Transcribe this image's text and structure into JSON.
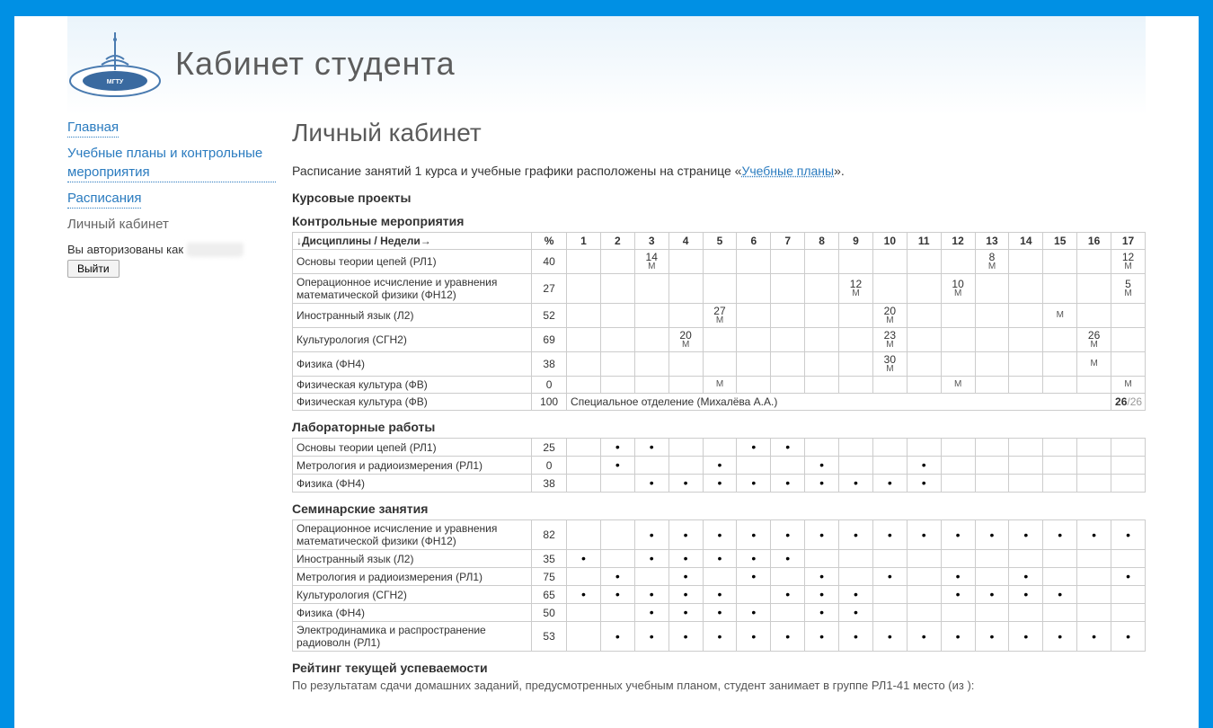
{
  "site": {
    "title": "Кабинет студента"
  },
  "nav": {
    "items": [
      {
        "label": "Главная",
        "current": false
      },
      {
        "label": "Учебные планы и контрольные мероприятия",
        "current": false
      },
      {
        "label": "Расписания",
        "current": false
      },
      {
        "label": "Личный кабинет",
        "current": true
      }
    ],
    "auth_prefix": "Вы авторизованы как ",
    "auth_user": "██████",
    "logout": "Выйти"
  },
  "page": {
    "heading": "Личный кабинет",
    "info_prefix": "Расписание занятий 1 курса и учебные графики расположены на странице «",
    "info_link": "Учебные планы",
    "info_suffix": "».",
    "section_projects": "Курсовые проекты",
    "section_km": "Контрольные мероприятия",
    "section_lab": "Лабораторные работы",
    "section_sem": "Семинарские занятия",
    "section_rating": "Рейтинг текущей успеваемости",
    "rating_tail": "По результатам сдачи домашних заданий, предусмотренных учебным планом, студент занимает в группе РЛ1-41 место (из ):"
  },
  "table_header": {
    "corner": "↓Дисциплины / Недели→",
    "pct": "%",
    "weeks": [
      "1",
      "2",
      "3",
      "4",
      "5",
      "6",
      "7",
      "8",
      "9",
      "10",
      "11",
      "12",
      "13",
      "14",
      "15",
      "16",
      "17"
    ]
  },
  "km_rows": [
    {
      "name": "Основы теории цепей (РЛ1)",
      "pct": "40",
      "cells": {
        "3": {
          "n": "14",
          "s": "М"
        },
        "13": {
          "n": "8",
          "s": "М"
        },
        "17": {
          "n": "12",
          "s": "М"
        }
      }
    },
    {
      "name": "Операционное исчисление и уравнения математической физики (ФН12)",
      "pct": "27",
      "cells": {
        "9": {
          "n": "12",
          "s": "М"
        },
        "12": {
          "n": "10",
          "s": "М"
        },
        "17": {
          "n": "5",
          "s": "М"
        }
      }
    },
    {
      "name": "Иностранный язык (Л2)",
      "pct": "52",
      "cells": {
        "5": {
          "n": "27",
          "s": "М"
        },
        "10": {
          "n": "20",
          "s": "М"
        },
        "15": {
          "n": "",
          "s": "М"
        }
      }
    },
    {
      "name": "Культурология (СГН2)",
      "pct": "69",
      "cells": {
        "4": {
          "n": "20",
          "s": "М"
        },
        "10": {
          "n": "23",
          "s": "М"
        },
        "16": {
          "n": "26",
          "s": "М"
        }
      }
    },
    {
      "name": "Физика (ФН4)",
      "pct": "38",
      "cells": {
        "10": {
          "n": "30",
          "s": "М"
        },
        "16": {
          "n": "",
          "s": "М"
        }
      }
    },
    {
      "name": "Физическая культура (ФВ)",
      "pct": "0",
      "cells": {
        "5": {
          "n": "",
          "s": "М"
        },
        "12": {
          "n": "",
          "s": "М"
        },
        "17": {
          "n": "",
          "s": "М"
        }
      }
    }
  ],
  "km_special": {
    "name": "Физическая культура (ФВ)",
    "pct": "100",
    "merged_text": "Специальное отделение (Михалёва А.А.)",
    "ratio_a": "26",
    "ratio_b": "/26"
  },
  "lab_rows": [
    {
      "name": "Основы теории цепей (РЛ1)",
      "pct": "25",
      "dots": [
        2,
        3,
        6,
        7
      ]
    },
    {
      "name": "Метрология и радиоизмерения (РЛ1)",
      "pct": "0",
      "dots": [
        2,
        5,
        8,
        11
      ]
    },
    {
      "name": "Физика (ФН4)",
      "pct": "38",
      "dots": [
        3,
        4,
        5,
        6,
        7,
        8,
        9,
        10,
        11
      ]
    }
  ],
  "sem_rows": [
    {
      "name": "Операционное исчисление и уравнения математической физики (ФН12)",
      "pct": "82",
      "dots": [
        3,
        4,
        5,
        6,
        7,
        8,
        9,
        10,
        11,
        12,
        13,
        14,
        15,
        16,
        17
      ]
    },
    {
      "name": "Иностранный язык (Л2)",
      "pct": "35",
      "dots": [
        1,
        3,
        4,
        5,
        6,
        7
      ]
    },
    {
      "name": "Метрология и радиоизмерения (РЛ1)",
      "pct": "75",
      "dots": [
        2,
        4,
        6,
        8,
        10,
        12,
        14,
        17
      ]
    },
    {
      "name": "Культурология (СГН2)",
      "pct": "65",
      "dots": [
        1,
        2,
        3,
        4,
        5,
        7,
        8,
        9,
        12,
        13,
        14,
        15
      ]
    },
    {
      "name": "Физика (ФН4)",
      "pct": "50",
      "dots": [
        3,
        4,
        5,
        6,
        8,
        9
      ]
    },
    {
      "name": "Электродинамика и распространение радиоволн (РЛ1)",
      "pct": "53",
      "dots": [
        2,
        3,
        4,
        5,
        6,
        7,
        8,
        9,
        10,
        11,
        12,
        13,
        14,
        15,
        16,
        17
      ]
    }
  ]
}
